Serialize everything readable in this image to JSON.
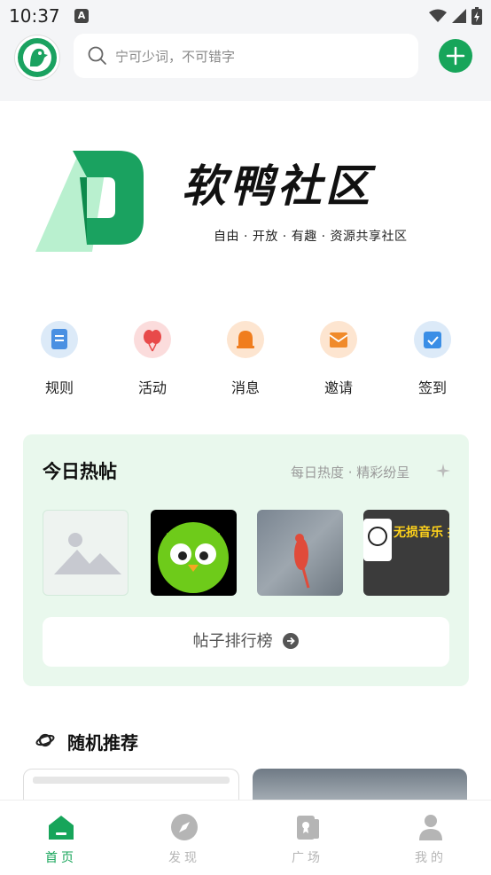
{
  "status_bar": {
    "time": "10:37",
    "badge": "A"
  },
  "search": {
    "placeholder": "宁可少词，不可错字"
  },
  "banner": {
    "title": "软鸭社区",
    "subtitle": "自由 · 开放 · 有趣 · 资源共享社区"
  },
  "quick_actions": [
    {
      "label": "规则",
      "icon": "document-icon",
      "color": "#4a90e2"
    },
    {
      "label": "活动",
      "icon": "balloon-icon",
      "color": "#e84a4a"
    },
    {
      "label": "消息",
      "icon": "bell-icon",
      "color": "#f07d1e"
    },
    {
      "label": "邀请",
      "icon": "envelope-icon",
      "color": "#f08a2a"
    },
    {
      "label": "签到",
      "icon": "calendar-check-icon",
      "color": "#3a8ee6"
    }
  ],
  "hot_posts": {
    "title": "今日热帖",
    "subtitle": "每日热度 · 精彩纷呈",
    "rank_button": "帖子排行榜",
    "thumbnail_text": "无损音乐 批量下载 入歌单超多音"
  },
  "random": {
    "title": "随机推荐"
  },
  "bottom_nav": [
    {
      "label": "首页",
      "active": true
    },
    {
      "label": "发现",
      "active": false
    },
    {
      "label": "广场",
      "active": false
    },
    {
      "label": "我的",
      "active": false
    }
  ],
  "colors": {
    "brand_green": "#17a55a",
    "hot_bg": "#e9f8ed",
    "inactive": "#b5b5b5"
  }
}
